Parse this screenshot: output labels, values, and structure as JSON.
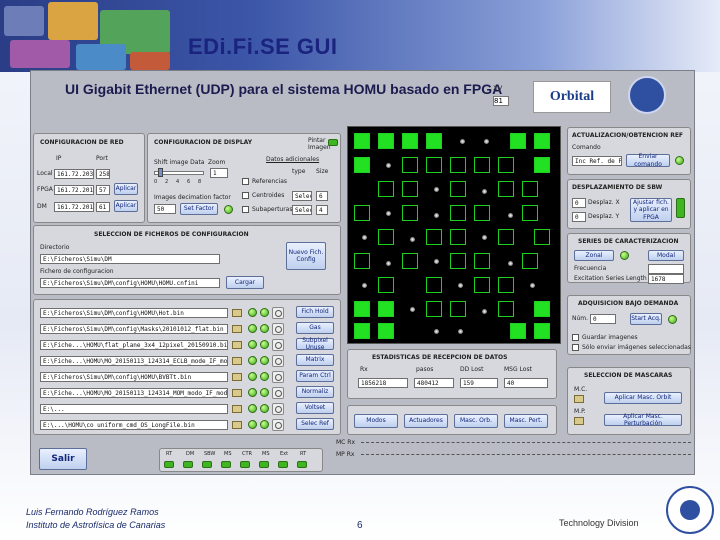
{
  "slide": {
    "title": "EDi.Fi.SE GUI",
    "footer_author": "Luis Fernando Rodríguez Ramos",
    "footer_institute": "Instituto de Astrofísica de Canarias",
    "page_number": "6",
    "footer_division": "Technology Division"
  },
  "app": {
    "title": "UI Gigabit Ethernet (UDP) para el sistema HOMU basado en FPGA",
    "xy_label": "xy",
    "xy_value": "81",
    "logo_text": "Orbital"
  },
  "network": {
    "title": "CONFIGURACION DE RED",
    "col_ip": "IP",
    "col_port": "Port",
    "rows": [
      {
        "label": "Local",
        "ip": "161.72.203.189",
        "port": "258",
        "button": ""
      },
      {
        "label": "FPGA",
        "ip": "161.72.201.193",
        "port": "57",
        "button": "Aplicar"
      },
      {
        "label": "DM",
        "ip": "161.72.201.203",
        "port": "61",
        "button": "Aplicar"
      }
    ]
  },
  "display": {
    "title": "CONFIGURACION DE DISPLAY",
    "pintar_label": "Pintar Imagen",
    "shift_label": "Shift image Data",
    "zoom_label": "Zoom",
    "zoom_value": "1",
    "slider_ticks": [
      "0",
      "2",
      "4",
      "6",
      "8"
    ],
    "decimation_label": "Images decimation factor",
    "decimation_value": "50",
    "set_factor": "Set Factor",
    "extra_title": "Datos adicionales",
    "type_label": "type",
    "size_label": "Size",
    "referencias": "Referencias",
    "centroides": "Centroides",
    "subaperturas": "Subaperturas",
    "centroides_type": "Selec",
    "centroides_size": "6",
    "subap_type": "Selec",
    "subap_size": "4"
  },
  "files": {
    "title": "SELECCION DE FICHEROS DE CONFIGURACION",
    "dir_label": "Directorio",
    "dir_value": "E:\\Ficheros\\Simu\\DM",
    "nuevo_button": "Nuevo Fich. Config",
    "config_label": "Fichero de configuracion",
    "config_value": "E:\\Ficheros\\Simu\\DM\\config\\HOMU\\HOMU.cnfini",
    "cargar": "Cargar",
    "rows": [
      {
        "path": "E:\\Ficheros\\Simu\\DM\\config\\HOMU\\Hot.bin",
        "button": "Fich Hold"
      },
      {
        "path": "E:\\Ficheros\\Simu\\DM\\config\\Masks\\20101012_flat.bin",
        "button": "Gas"
      },
      {
        "path": "E:\\Fiche...\\HOMU\\flat_plane_3x4_12pixel_20150910.bin",
        "button": "Subpixel Unuse"
      },
      {
        "path": "E:\\Fiche...\\HOMU\\MO_20150113_124314_ECLB_mode_IF_modos.bin",
        "button": "Matrix"
      },
      {
        "path": "E:\\Ficheros\\Simu\\DM\\config\\HOMU\\BVBTt.bin",
        "button": "Param Ctrl"
      },
      {
        "path": "E:\\Fiche...\\HOMU\\MO_20150113_124314_MOM_modo_IF_modos.bin",
        "button": "Normaliz"
      },
      {
        "path": "E:\\...",
        "button": "Voltset"
      },
      {
        "path": "E:\\...\\HOMU\\co uniform_cmd_OS_LongFile.bin",
        "button": "Selec Ref"
      }
    ]
  },
  "refs": {
    "title": "ACTUALIZACION/OBTENCION REF",
    "comando_label": "Comando",
    "comando_value": "Inc Ref. de FPGA",
    "enviar": "Enviar comando"
  },
  "sbw": {
    "title": "DESPLAZAMIENTO DE SBW",
    "x_label": "Desplaz. X",
    "y_label": "Desplaz. Y",
    "x_value": "0",
    "y_value": "0",
    "apply": "Ajustar fich. y aplicar en FPGA"
  },
  "series": {
    "title": "SERIES DE CARACTERIZACION",
    "zonal": "Zonal",
    "modal": "Modal",
    "freq_label": "Frecuencia",
    "freq_value": "",
    "len_label": "Excitation Series Length",
    "len_value": "1678"
  },
  "acq": {
    "title": "ADQUISICION BAJO DEMANDA",
    "num_label": "Núm.",
    "num_value": "0",
    "start": "Start Acq.",
    "opt1": "Guardar imagenes",
    "opt2": "Sólo enviar imágenes seleccionadas"
  },
  "stats": {
    "title": "ESTADISTICAS DE RECEPCION DE DATOS",
    "cols": [
      "Rx",
      "pasos",
      "DD Lost",
      "MSG Lost"
    ],
    "values": [
      "1856218",
      "480412",
      "159",
      "40"
    ]
  },
  "masks": {
    "title": "SELECCION DE MASCARAS",
    "mlc": "M.C.",
    "mp": "M.P.",
    "btn1": "Aplicar Masc. Orbit",
    "btn2": "Aplicar Masc. Perturbación"
  },
  "bottom_buttons": [
    "Modos",
    "Actuadores",
    "Masc. Orb.",
    "Masc. Pert."
  ],
  "rx": {
    "mc": "MC Rx",
    "mp": "MP Rx"
  },
  "exit": "Salir",
  "indicators": {
    "labels": [
      "RT",
      "DM",
      "SBW",
      "MS",
      "CTR",
      "MS",
      "Ext",
      "RT"
    ]
  }
}
